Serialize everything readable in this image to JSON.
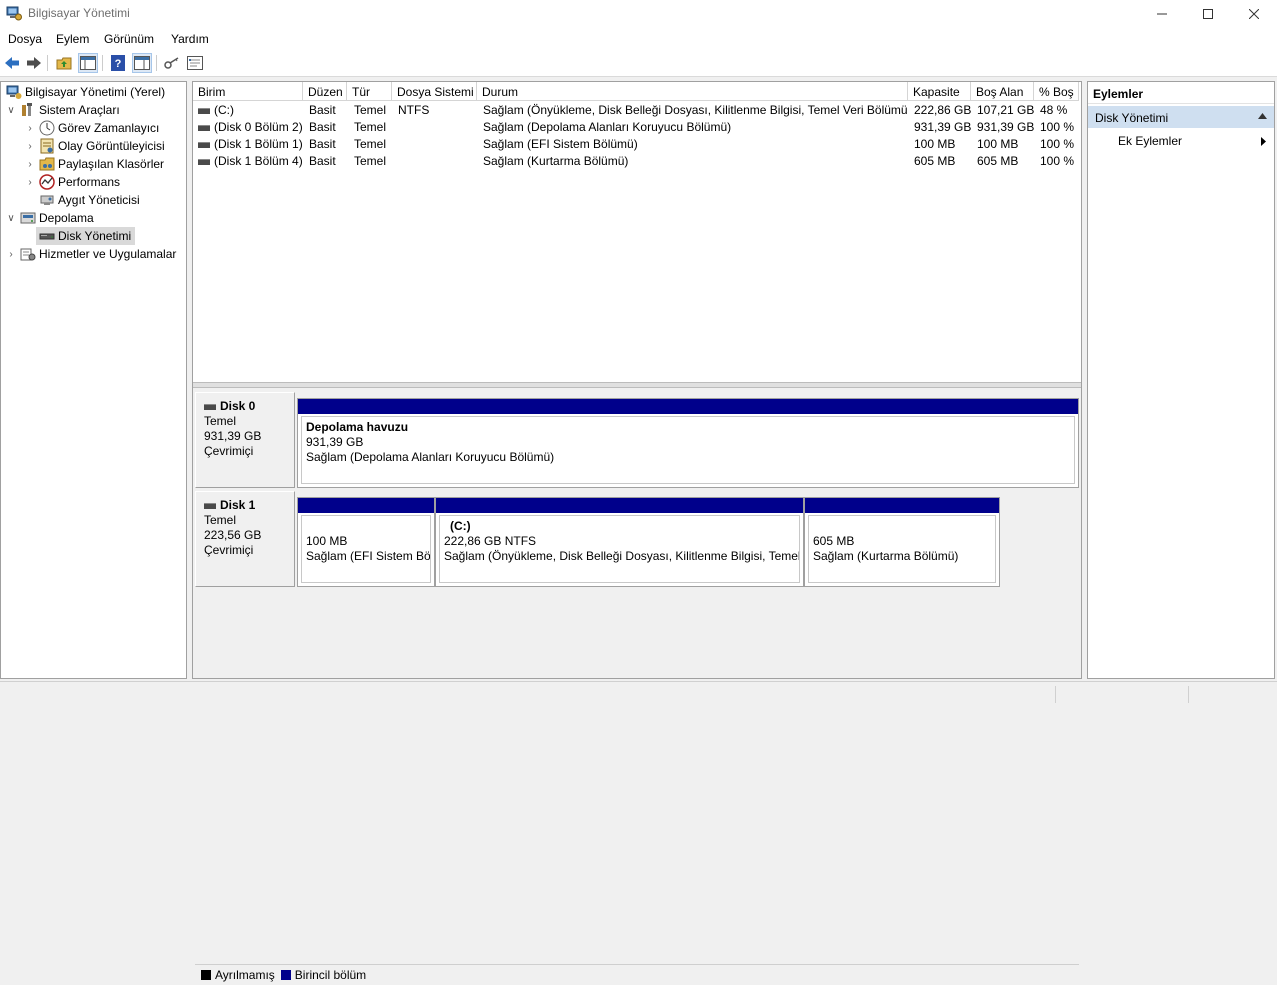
{
  "window": {
    "title": "Bilgisayar Yönetimi"
  },
  "menu": [
    "Dosya",
    "Eylem",
    "Görünüm",
    "Yardım"
  ],
  "tree": {
    "root": "Bilgisayar Yönetimi (Yerel)",
    "system_tools": "Sistem Araçları",
    "task_scheduler": "Görev Zamanlayıcı",
    "event_viewer": "Olay Görüntüleyicisi",
    "shared_folders": "Paylaşılan Klasörler",
    "performance": "Performans",
    "device_manager": "Aygıt Yöneticisi",
    "storage": "Depolama",
    "disk_management": "Disk Yönetimi",
    "services": "Hizmetler ve Uygulamalar"
  },
  "volume_list": {
    "columns": [
      "Birim",
      "Düzen",
      "Tür",
      "Dosya Sistemi",
      "Durum",
      "Kapasite",
      "Boş Alan",
      "% Boş"
    ],
    "rows": [
      [
        "(C:)",
        "Basit",
        "Temel",
        "NTFS",
        "Sağlam (Önyükleme, Disk Belleği Dosyası, Kilitlenme Bilgisi, Temel Veri Bölümü)",
        "222,86 GB",
        "107,21 GB",
        "48 %"
      ],
      [
        "(Disk 0 Bölüm 2)",
        "Basit",
        "Temel",
        "",
        "Sağlam (Depolama Alanları Koruyucu Bölümü)",
        "931,39 GB",
        "931,39 GB",
        "100 %"
      ],
      [
        "(Disk 1 Bölüm 1)",
        "Basit",
        "Temel",
        "",
        "Sağlam (EFI Sistem Bölümü)",
        "100 MB",
        "100 MB",
        "100 %"
      ],
      [
        "(Disk 1 Bölüm 4)",
        "Basit",
        "Temel",
        "",
        "Sağlam (Kurtarma Bölümü)",
        "605 MB",
        "605 MB",
        "100 %"
      ]
    ]
  },
  "disks": {
    "disk0": {
      "name": "Disk 0",
      "type": "Temel",
      "size": "931,39 GB",
      "state": "Çevrimiçi",
      "p1": {
        "title": "Depolama havuzu",
        "size": "931,39 GB",
        "status": "Sağlam (Depolama Alanları Koruyucu Bölümü)"
      }
    },
    "disk1": {
      "name": "Disk 1",
      "type": "Temel",
      "size": "223,56 GB",
      "state": "Çevrimiçi",
      "p1": {
        "size": "100 MB",
        "status": "Sağlam (EFI Sistem Bölü"
      },
      "p2": {
        "title": "(C:)",
        "size": "222,86 GB NTFS",
        "status": "Sağlam (Önyükleme, Disk Belleği Dosyası, Kilitlenme Bilgisi, Temel V"
      },
      "p3": {
        "size": "605 MB",
        "status": "Sağlam (Kurtarma Bölümü)"
      }
    }
  },
  "legend": {
    "unallocated": "Ayrılmamış",
    "primary": "Birincil bölüm"
  },
  "colors": {
    "primary_partition": "#00008b",
    "unallocated": "#000000",
    "selection": "#cfdff0"
  },
  "actions": {
    "header": "Eylemler",
    "section": "Disk Yönetimi",
    "more": "Ek Eylemler"
  }
}
